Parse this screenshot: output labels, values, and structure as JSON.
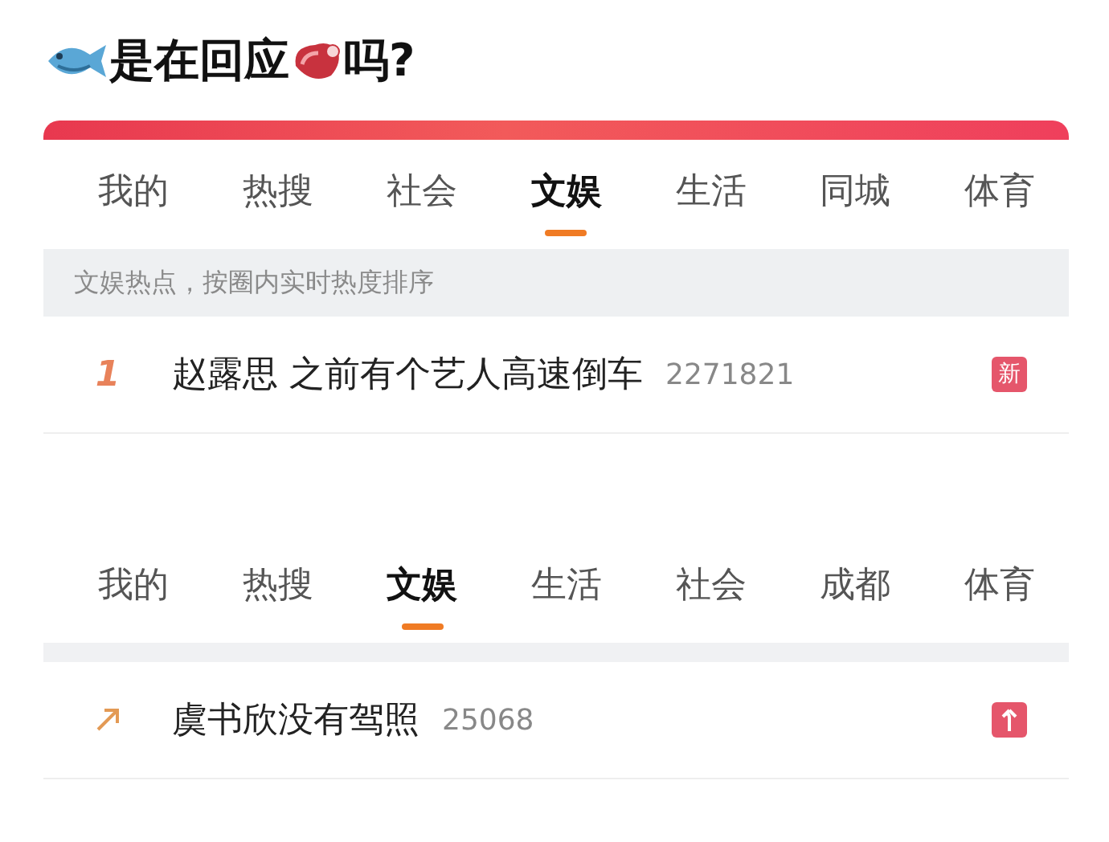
{
  "heading": {
    "before": "是在回应",
    "after": "吗?"
  },
  "sections": [
    {
      "tabs": [
        {
          "label": "我的",
          "selected": false
        },
        {
          "label": "热搜",
          "selected": false
        },
        {
          "label": "社会",
          "selected": false
        },
        {
          "label": "文娱",
          "selected": true
        },
        {
          "label": "生活",
          "selected": false
        },
        {
          "label": "同城",
          "selected": false
        },
        {
          "label": "体育",
          "selected": false
        }
      ],
      "subtitle": "文娱热点，按圈内实时热度排序",
      "entries": [
        {
          "kind": "rank",
          "rank": "1",
          "title": "赵露思 之前有个艺人高速倒车",
          "count": "2271821",
          "badge": {
            "kind": "new",
            "text": "新"
          }
        }
      ]
    },
    {
      "tabs": [
        {
          "label": "我的",
          "selected": false
        },
        {
          "label": "热搜",
          "selected": false
        },
        {
          "label": "文娱",
          "selected": true
        },
        {
          "label": "生活",
          "selected": false
        },
        {
          "label": "社会",
          "selected": false
        },
        {
          "label": "成都",
          "selected": false
        },
        {
          "label": "体育",
          "selected": false
        }
      ],
      "entries": [
        {
          "kind": "trend",
          "title": "虞书欣没有驾照",
          "count": "25068",
          "badge": {
            "kind": "up"
          }
        }
      ]
    }
  ]
}
